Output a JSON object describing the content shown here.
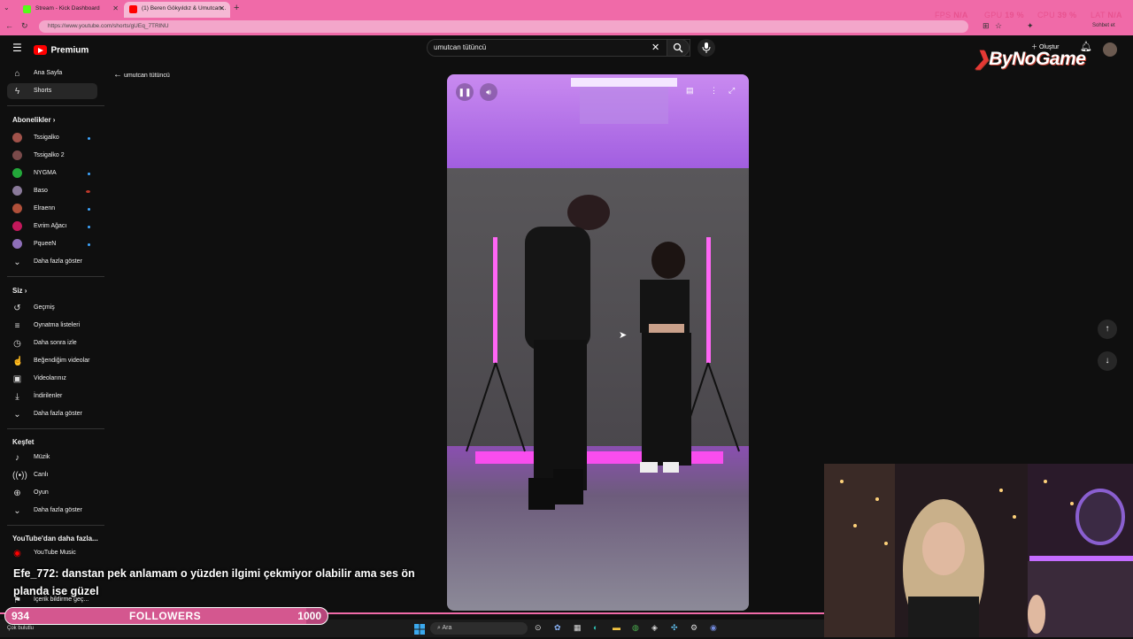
{
  "tabs": [
    {
      "title": "Stream - Kick Dashboard",
      "color": "#53fc18"
    },
    {
      "title": "(1) Beren Gökyıldız & Umutcan...",
      "color": "#ff0000"
    }
  ],
  "url": "https://www.youtube.com/shorts/gUEq_7TRlNU",
  "stats": {
    "fps_label": "FPS",
    "fps": "N/A",
    "gpu_label": "GPU",
    "gpu": "19 %",
    "cpu_label": "CPU",
    "cpu": "39 %",
    "lat_label": "LAT",
    "lat": "N/A"
  },
  "topbar": {
    "logo": "Premium",
    "search_value": "umutcan tütüncü",
    "create_label": "Oluştur",
    "chat_label": "Sohbet et"
  },
  "sidebar": {
    "main": [
      {
        "label": "Ana Sayfa",
        "icon": "home-icon"
      },
      {
        "label": "Shorts",
        "icon": "shorts-icon"
      }
    ],
    "subs_heading": "Abonelikler",
    "subs": [
      {
        "label": "Tssigalko",
        "color": "#a0524a",
        "dot": "#3ea6ff"
      },
      {
        "label": "Tssigalko 2",
        "color": "#7a4a4a",
        "dot": ""
      },
      {
        "label": "NYGMA",
        "color": "#23a83a",
        "dot": "#3ea6ff"
      },
      {
        "label": "Baso",
        "color": "#8a7a9a",
        "dot": "#c0392b"
      },
      {
        "label": "Elraenn",
        "color": "#b0503a",
        "dot": "#3ea6ff"
      },
      {
        "label": "Evrim Ağacı",
        "color": "#c2185b",
        "dot": "#3ea6ff"
      },
      {
        "label": "PqueeN",
        "color": "#8e6fb8",
        "dot": "#3ea6ff"
      }
    ],
    "subs_more": "Daha fazla göster",
    "you_heading": "Siz",
    "you": [
      {
        "label": "Geçmiş",
        "icon": "history-icon"
      },
      {
        "label": "Oynatma listeleri",
        "icon": "playlist-icon"
      },
      {
        "label": "Daha sonra izle",
        "icon": "clock-icon"
      },
      {
        "label": "Beğendiğim videolar",
        "icon": "like-icon"
      },
      {
        "label": "Videolarınız",
        "icon": "video-icon"
      },
      {
        "label": "İndirilenler",
        "icon": "download-icon"
      }
    ],
    "you_more": "Daha fazla göster",
    "explore_heading": "Keşfet",
    "explore": [
      {
        "label": "Müzik",
        "icon": "music-icon"
      },
      {
        "label": "Canlı",
        "icon": "live-icon"
      },
      {
        "label": "Oyun",
        "icon": "game-icon"
      }
    ],
    "explore_more": "Daha fazla göster",
    "more_heading": "YouTube'dan daha fazla...",
    "more": [
      {
        "label": "YouTube Music",
        "icon": "yt-music-icon"
      },
      {
        "label": "İçerik bildirme geç...",
        "icon": "flag-icon"
      }
    ]
  },
  "back_label": "umutcan tütüncü",
  "chat_message": {
    "user": "Efe_772",
    "text": ": danstan pek anlamam o yüzden ilgimi çekmiyor olabilir ama ses ön planda ise güzel"
  },
  "followers": {
    "current": "934",
    "label": "FOLLOWERS",
    "goal": "1000",
    "progress": 0.934
  },
  "taskbar": {
    "search": "Ara",
    "weather": "Çok bulutlu"
  },
  "brand": "ByNoGame"
}
